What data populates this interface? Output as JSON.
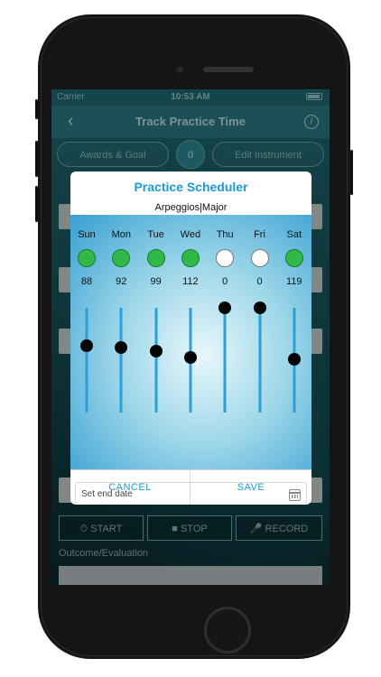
{
  "status_bar": {
    "carrier": "Carrier",
    "time": "10:53 AM"
  },
  "nav": {
    "title": "Track Practice Time",
    "back_icon": "chevron-left-icon",
    "info_icon": "info-icon"
  },
  "header_buttons": {
    "awards_label": "Awards & Goal",
    "count": "0",
    "edit_label": "Edit Instrument"
  },
  "background_form": {
    "outcome_label": "Outcome/Evaluation",
    "start_label": "START",
    "stop_label": "STOP",
    "record_label": "RECORD"
  },
  "modal": {
    "title": "Practice Scheduler",
    "subtitle": "Arpeggios|Major",
    "days": [
      {
        "label": "Sun",
        "active": true,
        "value": "88",
        "level": 0.64
      },
      {
        "label": "Mon",
        "active": true,
        "value": "92",
        "level": 0.62
      },
      {
        "label": "Tue",
        "active": true,
        "value": "99",
        "level": 0.59
      },
      {
        "label": "Wed",
        "active": true,
        "value": "112",
        "level": 0.53
      },
      {
        "label": "Thu",
        "active": false,
        "value": "0",
        "level": 1.0
      },
      {
        "label": "Fri",
        "active": false,
        "value": "0",
        "level": 1.0
      },
      {
        "label": "Sat",
        "active": true,
        "value": "119",
        "level": 0.51
      }
    ],
    "date_placeholder": "Set end date",
    "calendar_icon": "calendar-icon",
    "cancel_label": "CANCEL",
    "save_label": "SAVE"
  },
  "colors": {
    "accent": "#1b9bd6",
    "active_day": "#2fba47",
    "slider_track": "#2e9ed6"
  }
}
